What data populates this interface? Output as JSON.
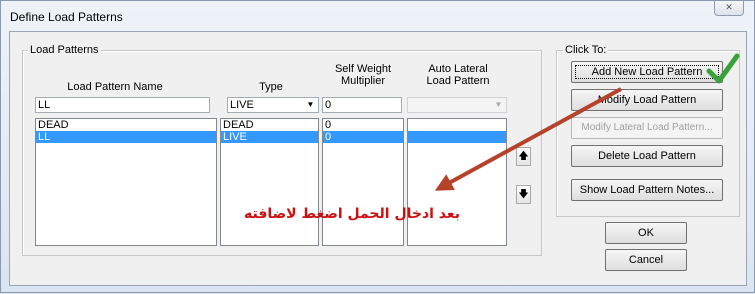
{
  "window": {
    "title": "Define Load Patterns",
    "close_icon": "close-icon"
  },
  "load_patterns": {
    "legend": "Load Patterns",
    "headers": {
      "name": "Load Pattern Name",
      "type": "Type",
      "self_weight_line1": "Self Weight",
      "self_weight_line2": "Multiplier",
      "auto_lateral_line1": "Auto Lateral",
      "auto_lateral_line2": "Load Pattern"
    },
    "edit_row": {
      "name": "LL",
      "type": "LIVE",
      "multiplier": "0",
      "auto_lateral": ""
    },
    "rows": [
      {
        "name": "DEAD",
        "type": "DEAD",
        "multiplier": "0",
        "auto_lateral": "",
        "selected": false
      },
      {
        "name": "LL",
        "type": "LIVE",
        "multiplier": "0",
        "auto_lateral": "",
        "selected": true
      }
    ],
    "move_up_icon": "arrow-up-icon",
    "move_down_icon": "arrow-down-icon"
  },
  "click_to": {
    "legend": "Click To:",
    "add": "Add New Load Pattern",
    "modify": "Modify Load Pattern",
    "modify_lateral": "Modify Lateral Load Pattern...",
    "delete": "Delete Load Pattern",
    "notes": "Show Load Pattern Notes..."
  },
  "ok": "OK",
  "cancel": "Cancel",
  "annotation": {
    "text": "بعد ادخال الحمل اضغط لاضافته",
    "color": "#cc1010",
    "arrow_color": "#b5432c",
    "check_icon": "checkmark-icon",
    "check_color": "#3aa23a"
  }
}
